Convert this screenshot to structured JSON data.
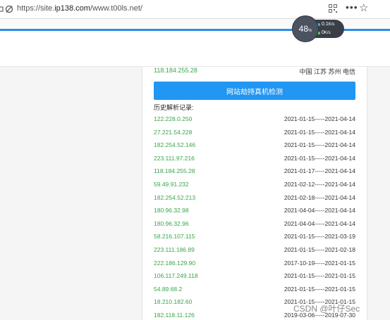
{
  "browser": {
    "url_prefix": "https://site.",
    "url_host": "ip138.com",
    "url_path": "/www.t00ls.net/",
    "more_icon": "•••",
    "star_icon": "☆"
  },
  "speed_widget": {
    "percent": "48",
    "percent_unit": "%",
    "up_value": "0.1",
    "up_unit": "K/s",
    "down_value": "0",
    "down_unit": "K/s",
    "up_color": "#31b8f1",
    "down_color": "#5fd35f"
  },
  "current": {
    "ip": "118.184.255.28",
    "location": "中国 江苏 苏州 电信"
  },
  "check_button": "网站劫持真机检测",
  "history_title": "历史解析记录:",
  "records": [
    {
      "ip": "122.228.0.250",
      "range": "2021-01-15-----2021-04-14"
    },
    {
      "ip": "27.221.54.228",
      "range": "2021-01-15-----2021-04-14"
    },
    {
      "ip": "182.254.52.146",
      "range": "2021-01-15-----2021-04-14"
    },
    {
      "ip": "223.111.97.216",
      "range": "2021-01-15-----2021-04-14"
    },
    {
      "ip": "118.184.255.28",
      "range": "2021-01-17-----2021-04-14"
    },
    {
      "ip": "59.49.91.232",
      "range": "2021-02-12-----2021-04-14"
    },
    {
      "ip": "182.254.52.213",
      "range": "2021-02-18-----2021-04-14"
    },
    {
      "ip": "180.96.32.98",
      "range": "2021-04-04-----2021-04-14"
    },
    {
      "ip": "180.96.32.96",
      "range": "2021-04-04-----2021-04-14"
    },
    {
      "ip": "58.216.107.115",
      "range": "2021-01-15-----2021-03-19"
    },
    {
      "ip": "223.111.186.89",
      "range": "2021-01-15-----2021-02-18"
    },
    {
      "ip": "222.186.129.90",
      "range": "2017-10-19-----2021-01-15"
    },
    {
      "ip": "106.117.249.118",
      "range": "2021-01-15-----2021-01-15"
    },
    {
      "ip": "54.89.68.2",
      "range": "2021-01-15-----2021-01-15"
    },
    {
      "ip": "18.210.182.60",
      "range": "2021-01-15-----2021-01-15"
    },
    {
      "ip": "182.118.11.126",
      "range": "2019-03-06-----2019-07-30"
    }
  ],
  "watermark": "CSDN @叶仔Sec",
  "colors": {
    "ip_green": "#3aa64a",
    "button_blue": "#2196f3",
    "accent_line": "#2d8ce7"
  }
}
